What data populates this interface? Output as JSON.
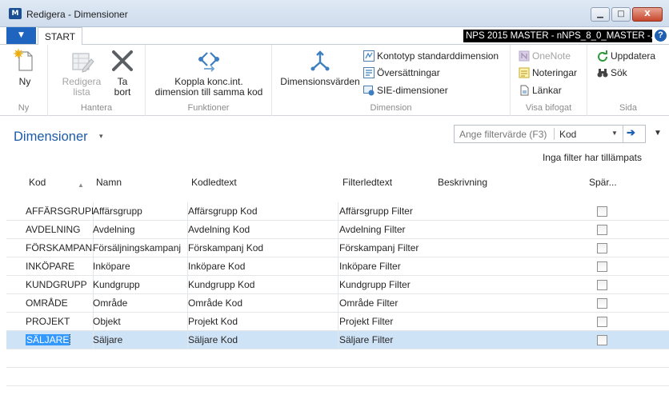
{
  "window": {
    "title": "Redigera - Dimensioner",
    "app_icon": "M",
    "minimize": "▁",
    "maximize": "□",
    "close": "X"
  },
  "ribbon_tabs": {
    "app_menu": "▼",
    "start": "START",
    "company": "NPS 2015 MASTER - nNPS_8_0_MASTER -...",
    "help": "?"
  },
  "ribbon": {
    "ny": {
      "label": "Ny",
      "group": "Ny"
    },
    "hantera": {
      "group": "Hantera",
      "edit_list": [
        "Redigera",
        "lista"
      ],
      "delete": [
        "Ta",
        "bort"
      ]
    },
    "funktioner": {
      "group": "Funktioner",
      "link": [
        "Koppla konc.int.",
        "dimension till samma kod"
      ]
    },
    "dimension": {
      "group": "Dimension",
      "values": "Dimensionsvärden",
      "kontotyp": "Kontotyp standarddimension",
      "translations": "Översättningar",
      "sie": "SIE-dimensioner"
    },
    "visa_bifogat": {
      "group": "Visa bifogat",
      "onenote": "OneNote",
      "notes": "Noteringar",
      "links": "Länkar"
    },
    "sida": {
      "group": "Sida",
      "refresh": "Uppdatera",
      "search": "Sök"
    }
  },
  "page": {
    "title": "Dimensioner",
    "caret": "▾",
    "filter_placeholder": "Ange filtervärde (F3)",
    "filter_field": "Kod",
    "filter_drop": "▼",
    "filter_go": "➔",
    "collapse": "▼",
    "no_filter_text": "Inga filter har tillämpats"
  },
  "table": {
    "columns": [
      "Kod",
      "Namn",
      "Kodledtext",
      "Filterledtext",
      "Beskrivning",
      "Spär..."
    ],
    "sort_arrow": "▲",
    "rows": [
      {
        "kod": "AFFÄRSGRUPP",
        "namn": "Affärsgrupp",
        "kodledtext": "Affärsgrupp Kod",
        "filterledtext": "Affärsgrupp Filter",
        "beskrivning": "",
        "sparr": false
      },
      {
        "kod": "AVDELNING",
        "namn": "Avdelning",
        "kodledtext": "Avdelning Kod",
        "filterledtext": "Avdelning Filter",
        "beskrivning": "",
        "sparr": false
      },
      {
        "kod": "FÖRSKAMPANJ",
        "namn": "Försäljningskampanj",
        "kodledtext": "Förskampanj Kod",
        "filterledtext": "Förskampanj Filter",
        "beskrivning": "",
        "sparr": false
      },
      {
        "kod": "INKÖPARE",
        "namn": "Inköpare",
        "kodledtext": "Inköpare Kod",
        "filterledtext": "Inköpare Filter",
        "beskrivning": "",
        "sparr": false
      },
      {
        "kod": "KUNDGRUPP",
        "namn": "Kundgrupp",
        "kodledtext": "Kundgrupp Kod",
        "filterledtext": "Kundgrupp Filter",
        "beskrivning": "",
        "sparr": false
      },
      {
        "kod": "OMRÅDE",
        "namn": "Område",
        "kodledtext": "Område Kod",
        "filterledtext": "Område Filter",
        "beskrivning": "",
        "sparr": false
      },
      {
        "kod": "PROJEKT",
        "namn": "Objekt",
        "kodledtext": "Projekt Kod",
        "filterledtext": "Projekt Filter",
        "beskrivning": "",
        "sparr": false
      },
      {
        "kod": "SÄLJARE",
        "namn": "Säljare",
        "kodledtext": "Säljare Kod",
        "filterledtext": "Säljare Filter",
        "beskrivning": "",
        "sparr": false,
        "selected": true
      }
    ]
  },
  "colors": {
    "title_blue": "#1d5aa5",
    "selection_row": "#cfe3f7",
    "selection_text": "#3399ff",
    "app_menu": "#1f64bf"
  }
}
